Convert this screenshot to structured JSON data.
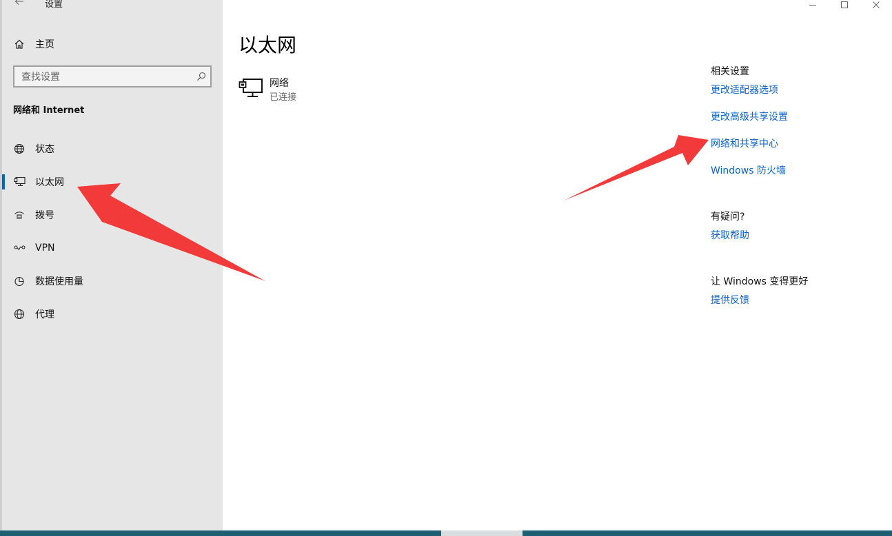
{
  "app": {
    "title": "设置"
  },
  "sidebar": {
    "home_label": "主页",
    "search_placeholder": "查找设置",
    "section_title": "网络和 Internet",
    "items": [
      {
        "label": "状态",
        "icon": "globe-status-icon",
        "selected": false
      },
      {
        "label": "以太网",
        "icon": "ethernet-icon",
        "selected": true
      },
      {
        "label": "拨号",
        "icon": "dialup-icon",
        "selected": false
      },
      {
        "label": "VPN",
        "icon": "vpn-icon",
        "selected": false
      },
      {
        "label": "数据使用量",
        "icon": "data-usage-icon",
        "selected": false
      },
      {
        "label": "代理",
        "icon": "globe-proxy-icon",
        "selected": false
      }
    ]
  },
  "main": {
    "title": "以太网",
    "network": {
      "name": "网络",
      "status": "已连接",
      "icon": "ethernet-icon"
    }
  },
  "related": {
    "heading": "相关设置",
    "links": [
      "更改适配器选项",
      "更改高级共享设置",
      "网络和共享中心",
      "Windows 防火墙"
    ],
    "help_heading": "有疑问?",
    "help_link": "获取帮助",
    "feedback_heading": "让 Windows 变得更好",
    "feedback_link": "提供反馈"
  },
  "colors": {
    "accent": "#0067c0",
    "link": "#0a64c8",
    "annotation_arrow": "#f23a3a",
    "sidebar_bg": "#e6e6e6"
  }
}
